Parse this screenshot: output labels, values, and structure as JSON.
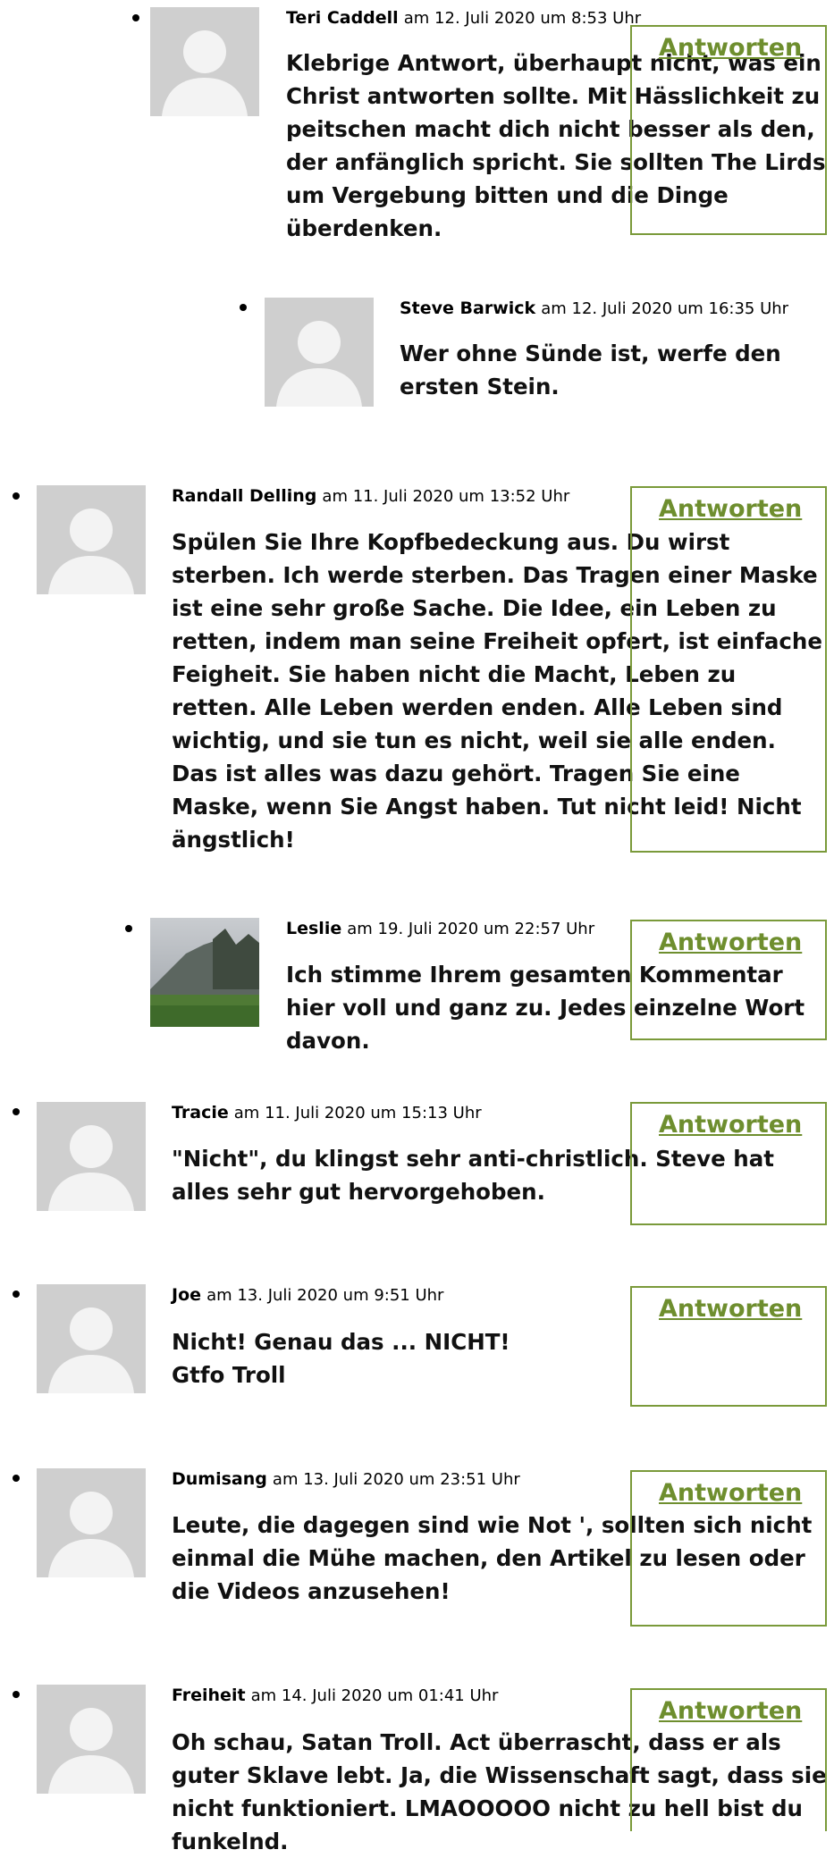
{
  "reply_label": "Antworten",
  "accent_color": "#7a9a3a",
  "comments": [
    {
      "author": "Teri Caddell",
      "date": "am 12. Juli 2020 um 8:53 Uhr",
      "text": "Klebrige Antwort, überhaupt nicht, was ein Christ antworten sollte. Mit Hässlichkeit zu peitschen macht dich nicht besser als den, der anfänglich spricht. Sie sollten The Lirds um Vergebung bitten und die Dinge überdenken.",
      "avatar": "default-avatar"
    },
    {
      "author": "Steve Barwick",
      "date": "am 12. Juli 2020 um 16:35 Uhr",
      "text": "Wer ohne Sünde ist, werfe den ersten Stein.",
      "avatar": "default-avatar"
    },
    {
      "author": "Randall Delling",
      "date": "am 11. Juli 2020 um 13:52 Uhr",
      "text": "Spülen Sie Ihre Kopfbedeckung aus. Du wirst sterben. Ich werde sterben. Das Tragen einer Maske ist eine sehr große Sache. Die Idee, ein Leben zu retten, indem man seine Freiheit opfert, ist einfache Feigheit. Sie haben nicht die Macht, Leben zu retten. Alle Leben werden enden. Alle Leben sind wichtig, und sie tun es nicht, weil sie alle enden. Das ist alles was dazu gehört. Tragen Sie eine Maske, wenn Sie Angst haben. Tut nicht leid! Nicht ängstlich!",
      "avatar": "default-avatar"
    },
    {
      "author": "Leslie",
      "date": "am 19. Juli 2020 um 22:57 Uhr",
      "text": "Ich stimme Ihrem gesamten Kommentar hier voll und ganz zu. Jedes einzelne Wort davon.",
      "avatar": "landscape-photo-avatar"
    },
    {
      "author": "Tracie",
      "date": "am 11. Juli 2020 um 15:13 Uhr",
      "text": "\"Nicht\", du klingst sehr anti-christlich. Steve hat alles sehr gut hervorgehoben.",
      "avatar": "default-avatar"
    },
    {
      "author": "Joe",
      "date": "am 13. Juli 2020 um 9:51 Uhr",
      "text_lines": [
        "Nicht! Genau das ... NICHT!",
        "Gtfo Troll"
      ],
      "avatar": "default-avatar"
    },
    {
      "author": "Dumisang",
      "date": "am 13. Juli 2020 um 23:51 Uhr",
      "text": "Leute, die dagegen sind wie Not ', sollten sich nicht einmal die Mühe machen, den Artikel zu lesen oder die Videos anzusehen!",
      "avatar": "default-avatar"
    },
    {
      "author": "Freiheit",
      "date": "am 14. Juli 2020 um 01:41 Uhr",
      "text": "Oh schau, Satan Troll. Act überrascht, dass er als guter Sklave lebt. Ja, die Wissenschaft sagt, dass sie nicht funktioniert. LMAOOOOO nicht zu hell bist du funkelnd.",
      "avatar": "default-avatar"
    }
  ]
}
